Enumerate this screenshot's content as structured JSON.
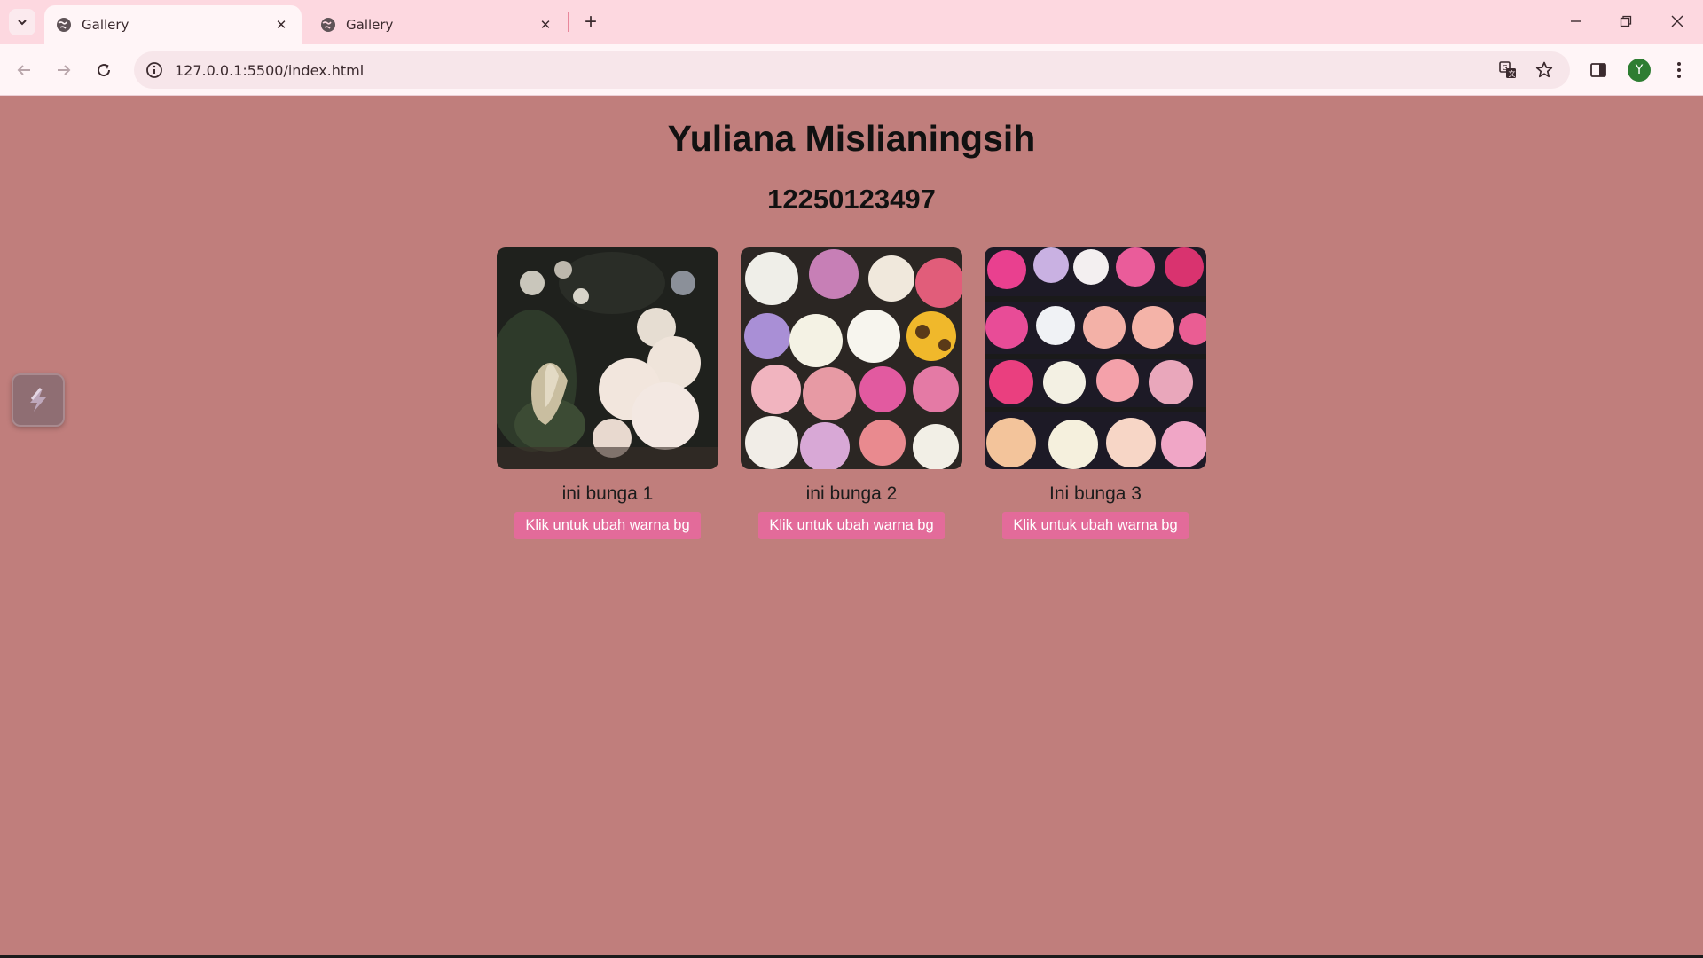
{
  "browser": {
    "tabs": [
      {
        "title": "Gallery",
        "active": true
      },
      {
        "title": "Gallery",
        "active": false
      }
    ],
    "url": "127.0.0.1:5500/index.html",
    "profile_initial": "Y",
    "colors": {
      "tabbar": "#fdd8e0",
      "toolbar": "#fff5f7",
      "avatar": "#2e7d32"
    }
  },
  "page": {
    "name": "Yuliana Mislianingsih",
    "student_id": "12250123497",
    "background": "#c07e7c",
    "button_color": "#e36b9a",
    "cards": [
      {
        "caption": "ini bunga 1",
        "button_label": "Klik untuk ubah warna bg",
        "image": "dark moody painting of white flowers"
      },
      {
        "caption": "ini bunga 2",
        "button_label": "Klik untuk ubah warna bg",
        "image": "flower market buckets with sunflowers and roses"
      },
      {
        "caption": "Ini bunga 3",
        "button_label": "Klik untuk ubah warna bg",
        "image": "shelves of pink and white rose bouquets"
      }
    ]
  },
  "icons": {
    "tab_list": "chevron-down-icon",
    "globe": "globe-icon",
    "close": "close-icon",
    "new_tab": "plus-icon",
    "minimize": "minimize-icon",
    "restore": "restore-icon",
    "window_close": "close-icon",
    "back": "back-arrow-icon",
    "forward": "forward-arrow-icon",
    "reload": "reload-icon",
    "info": "info-icon",
    "translate": "translate-icon",
    "bookmark": "star-icon",
    "side_panel": "side-panel-icon",
    "menu": "kebab-menu-icon",
    "extension": "lightning-icon"
  }
}
